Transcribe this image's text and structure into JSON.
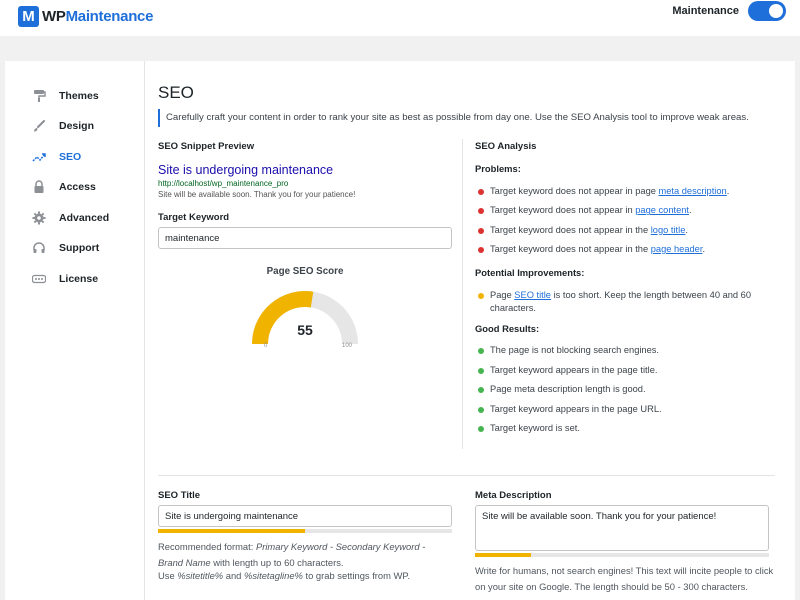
{
  "header": {
    "logo_mark": "M",
    "logo_wp": "WP",
    "logo_maint": "Maintenance",
    "maintenance_label": "Maintenance",
    "maintenance_on": true
  },
  "sidebar": {
    "items": [
      {
        "label": "Themes",
        "icon": "paint-roller-icon"
      },
      {
        "label": "Design",
        "icon": "brush-icon"
      },
      {
        "label": "SEO",
        "icon": "trend-icon",
        "active": true
      },
      {
        "label": "Access",
        "icon": "lock-icon"
      },
      {
        "label": "Advanced",
        "icon": "gear-icon"
      },
      {
        "label": "Support",
        "icon": "support-icon"
      },
      {
        "label": "License",
        "icon": "dots-icon"
      }
    ]
  },
  "main": {
    "title": "SEO",
    "intro": "Carefully craft your content in order to rank your site as best as possible from day one. Use the SEO Analysis tool to improve weak areas.",
    "snippet": {
      "heading": "SEO Snippet Preview",
      "title": "Site is undergoing maintenance",
      "url": "http://localhost/wp_maintenance_pro",
      "desc": "Site will be available soon. Thank you for your patience!"
    },
    "keyword": {
      "label": "Target Keyword",
      "value": "maintenance"
    },
    "score": {
      "title": "Page SEO Score",
      "value": 55,
      "min": "0",
      "max": "100"
    },
    "analysis": {
      "heading": "SEO Analysis",
      "problems_heading": "Problems:",
      "problems": [
        {
          "text": "Target keyword does not appear in page ",
          "link": "meta description",
          "after": "."
        },
        {
          "text": "Target keyword does not appear in ",
          "link": "page content",
          "after": "."
        },
        {
          "text": "Target keyword does not appear in the ",
          "link": "logo title",
          "after": "."
        },
        {
          "text": "Target keyword does not appear in the ",
          "link": "page header",
          "after": "."
        }
      ],
      "improvements_heading": "Potential Improvements:",
      "improvements": [
        {
          "text": "Page ",
          "link": "SEO title",
          "after": " is too short. Keep the length between 40 and 60 characters."
        }
      ],
      "good_heading": "Good Results:",
      "good": [
        "The page is not blocking search engines.",
        "Target keyword appears in the page title.",
        "Page meta description length is good.",
        "Target keyword appears in the page URL.",
        "Target keyword is set."
      ]
    },
    "seo_title": {
      "label": "SEO Title",
      "value": "Site is undergoing maintenance",
      "progress": 0.5,
      "help1_prefix": "Recommended format: ",
      "help1_em": "Primary Keyword - Secondary Keyword - Brand Name",
      "help1_suffix": " with length up to 60 characters.",
      "help2_prefix": "Use ",
      "help2_em1": "%sitetitle%",
      "help2_mid": " and ",
      "help2_em2": "%sitetagline%",
      "help2_suffix": " to grab settings from WP."
    },
    "meta": {
      "label": "Meta Description",
      "value": "Site will be available soon. Thank you for your patience!",
      "progress": 0.19,
      "help": "Write for humans, not search engines! This text will incite people to click on your site on Google. The length should be 50 - 300 characters."
    }
  },
  "colors": {
    "accent": "#1e6fd9",
    "warning": "#f0b400",
    "error": "#dc3232",
    "success": "#46b450"
  }
}
